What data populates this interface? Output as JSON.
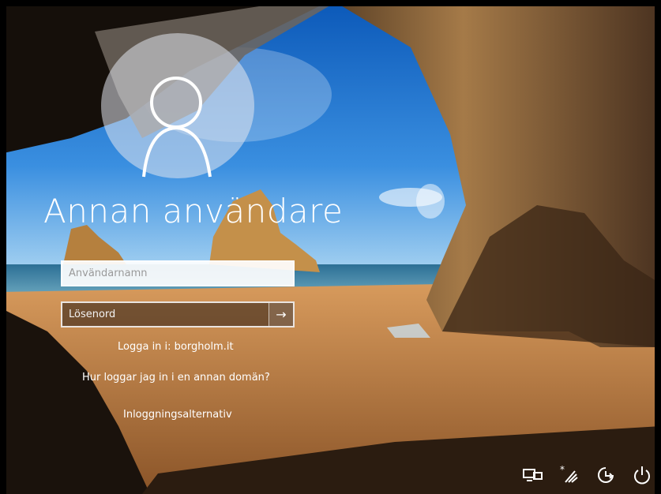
{
  "lock_screen": {
    "user_name": "Annan användare",
    "username_placeholder": "Användarnamn",
    "password_placeholder": "Lösenord",
    "submit_arrow": "→",
    "domain_text": "Logga in i: borgholm.it",
    "other_domain_link": "Hur loggar jag in i en annan domän?",
    "signin_options_link": "Inloggningsalternativ"
  },
  "tray_icons": [
    "network-status-icon",
    "wifi-icon",
    "accessibility-icon",
    "power-icon"
  ],
  "colors": {
    "text": "#ffffff",
    "field_border": "#ffffff",
    "sky": "#1f6fc8",
    "sand": "#b8743a",
    "rock": "#6e5236"
  }
}
